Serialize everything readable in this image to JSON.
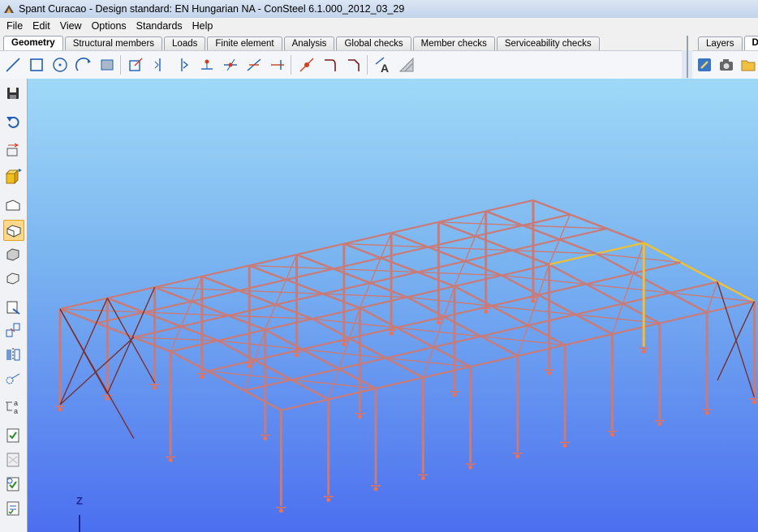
{
  "window": {
    "title": "Spant Curacao - Design standard: EN Hungarian NA - ConSteel 6.1.000_2012_03_29"
  },
  "menu": [
    "File",
    "Edit",
    "View",
    "Options",
    "Standards",
    "Help"
  ],
  "tabs": [
    "Geometry",
    "Structural members",
    "Loads",
    "Finite element",
    "Analysis",
    "Global checks",
    "Member checks",
    "Serviceability checks"
  ],
  "right_tabs": [
    "Layers",
    "Doc"
  ],
  "toolbar": {
    "icons": [
      "line-tool-icon",
      "rectangle-tool-icon",
      "circle-tool-icon",
      "arc-tool-icon",
      "polygon-tool-icon",
      "scale-tool-icon",
      "mirror-tool-icon",
      "offset-tool-icon",
      "node-tool-icon",
      "intersect-tool-icon",
      "divide-tool-icon",
      "trim-tool-icon",
      "point-on-line-icon",
      "fillet-tool-icon",
      "chamfer-tool-icon",
      "text-dimension-icon",
      "grid-tool-icon"
    ]
  },
  "sidebar": {
    "icons": [
      "save-icon",
      "undo-icon",
      "node-move-icon",
      "object-3d-icon",
      "view-front-icon",
      "view-iso-icon",
      "view-side-icon",
      "view-top-icon",
      "section-view-icon",
      "transform-icon",
      "mirror-view-icon",
      "node-select-icon",
      "label-icon",
      "check-list-icon",
      "check-grid-icon",
      "check-refresh-icon",
      "check-report-icon"
    ]
  },
  "viewport": {
    "axis_label": "Z"
  },
  "colors": {
    "member": "#c97b78",
    "selected_member": "#f0c030",
    "viewport_top": "#9fd9f8",
    "viewport_bottom": "#4c6ff0",
    "support": "#f07050"
  }
}
